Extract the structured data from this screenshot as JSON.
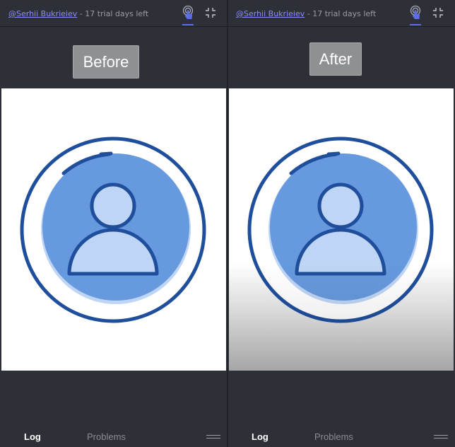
{
  "colors": {
    "accent": "#5b6ee6",
    "link": "#8c8cff",
    "avatar_dark": "#1f4e9c",
    "avatar_mid": "#6699dd",
    "avatar_light": "#bfd5f5"
  },
  "panes": [
    {
      "header": {
        "user_link": "@Serhii Bukrieiev",
        "separator": " - ",
        "trial_text": "17 trial days left",
        "touch_icon": "touch-icon",
        "collapse_icon": "collapse-icon"
      },
      "label_button": "Before",
      "footer": {
        "tab_log": "Log",
        "tab_problems": "Problems",
        "menu_icon": "menu-icon"
      }
    },
    {
      "header": {
        "user_link": "@Serhii Bukrieiev",
        "separator": " - ",
        "trial_text": "17 trial days left",
        "touch_icon": "touch-icon",
        "collapse_icon": "collapse-icon"
      },
      "label_button": "After",
      "footer": {
        "tab_log": "Log",
        "tab_problems": "Problems",
        "menu_icon": "menu-icon"
      }
    }
  ]
}
